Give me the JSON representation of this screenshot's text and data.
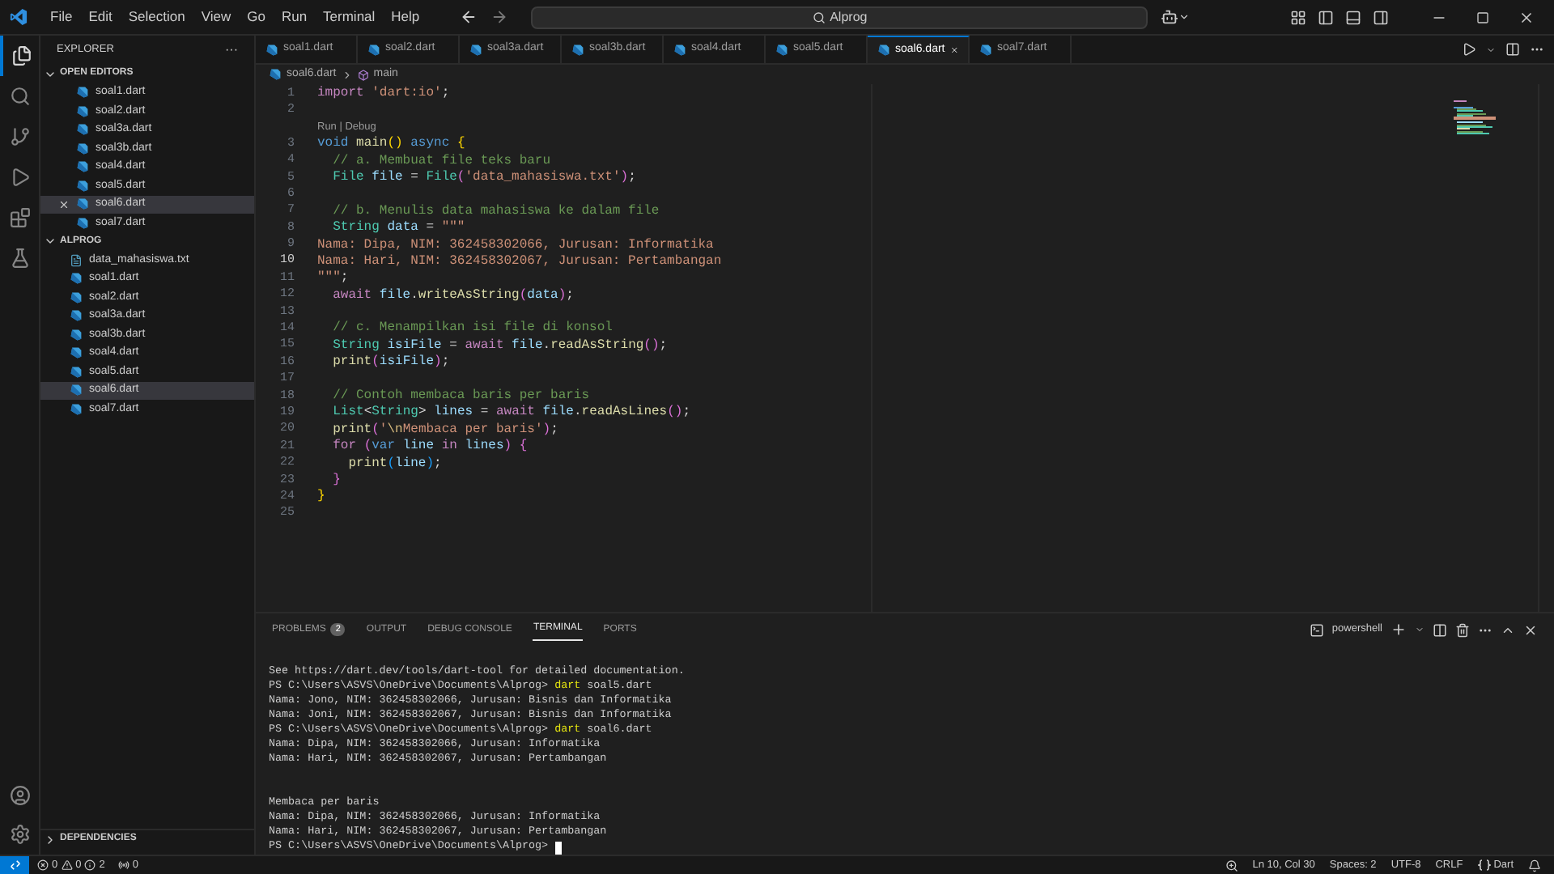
{
  "menu": [
    "File",
    "Edit",
    "Selection",
    "View",
    "Go",
    "Run",
    "Terminal",
    "Help"
  ],
  "search": {
    "value": "Alprog"
  },
  "sidebar": {
    "title": "EXPLORER",
    "more": "···",
    "sections": [
      {
        "label": "OPEN EDITORS",
        "expanded": true,
        "items": [
          {
            "label": "soal1.dart",
            "kind": "dart",
            "selected": false
          },
          {
            "label": "soal2.dart",
            "kind": "dart",
            "selected": false
          },
          {
            "label": "soal3a.dart",
            "kind": "dart",
            "selected": false
          },
          {
            "label": "soal3b.dart",
            "kind": "dart",
            "selected": false
          },
          {
            "label": "soal4.dart",
            "kind": "dart",
            "selected": false
          },
          {
            "label": "soal5.dart",
            "kind": "dart",
            "selected": false
          },
          {
            "label": "soal6.dart",
            "kind": "dart",
            "selected": true
          },
          {
            "label": "soal7.dart",
            "kind": "dart",
            "selected": false
          }
        ]
      },
      {
        "label": "ALPROG",
        "expanded": true,
        "items": [
          {
            "label": "data_mahasiswa.txt",
            "kind": "text",
            "selected": false
          },
          {
            "label": "soal1.dart",
            "kind": "dart",
            "selected": false
          },
          {
            "label": "soal2.dart",
            "kind": "dart",
            "selected": false
          },
          {
            "label": "soal3a.dart",
            "kind": "dart",
            "selected": false
          },
          {
            "label": "soal3b.dart",
            "kind": "dart",
            "selected": false
          },
          {
            "label": "soal4.dart",
            "kind": "dart",
            "selected": false
          },
          {
            "label": "soal5.dart",
            "kind": "dart",
            "selected": false
          },
          {
            "label": "soal6.dart",
            "kind": "dart",
            "selected": true
          },
          {
            "label": "soal7.dart",
            "kind": "dart",
            "selected": false
          }
        ]
      }
    ],
    "footer": {
      "label": "DEPENDENCIES",
      "expanded": false
    }
  },
  "tabs": [
    {
      "label": "soal1.dart",
      "selected": false
    },
    {
      "label": "soal2.dart",
      "selected": false
    },
    {
      "label": "soal3a.dart",
      "selected": false
    },
    {
      "label": "soal3b.dart",
      "selected": false
    },
    {
      "label": "soal4.dart",
      "selected": false
    },
    {
      "label": "soal5.dart",
      "selected": false
    },
    {
      "label": "soal6.dart",
      "selected": true
    },
    {
      "label": "soal7.dart",
      "selected": false
    }
  ],
  "breadcrumb": [
    "soal6.dart",
    "main"
  ],
  "code": [
    {
      "kind": "code",
      "number": "1",
      "current": false,
      "tokens": [
        {
          "text": "import ",
          "kind": "keyword"
        },
        {
          "text": "'dart:io'",
          "kind": "string"
        },
        {
          "text": ";",
          "kind": "plain"
        }
      ]
    },
    {
      "kind": "code",
      "number": "2",
      "current": false
    },
    {
      "kind": "codelens",
      "text": "Run | Debug"
    },
    {
      "kind": "code",
      "number": "3",
      "current": false,
      "tokens": [
        {
          "text": "void ",
          "kind": "storage"
        },
        {
          "text": "main",
          "kind": "function"
        },
        {
          "text": "() ",
          "kind": "bracket1"
        },
        {
          "text": "async ",
          "kind": "storage"
        },
        {
          "text": "{",
          "kind": "bracket1"
        }
      ]
    },
    {
      "kind": "code",
      "number": "4",
      "current": false,
      "tokens": [
        {
          "text": "  // a. Membuat file teks baru",
          "kind": "comment"
        }
      ]
    },
    {
      "kind": "code",
      "number": "5",
      "current": false,
      "tokens": [
        {
          "text": "  File ",
          "kind": "type"
        },
        {
          "text": "file",
          "kind": "variable"
        },
        {
          "text": " = ",
          "kind": "plain"
        },
        {
          "text": "File",
          "kind": "type"
        },
        {
          "text": "(",
          "kind": "bracket2"
        },
        {
          "text": "'data_mahasiswa.txt'",
          "kind": "string"
        },
        {
          "text": ")",
          "kind": "bracket2"
        },
        {
          "text": ";",
          "kind": "plain"
        }
      ]
    },
    {
      "kind": "code",
      "number": "6",
      "current": false
    },
    {
      "kind": "code",
      "number": "7",
      "current": false,
      "tokens": [
        {
          "text": "  // b. Menulis data mahasiswa ke dalam file",
          "kind": "comment"
        }
      ]
    },
    {
      "kind": "code",
      "number": "8",
      "current": false,
      "tokens": [
        {
          "text": "  String ",
          "kind": "type"
        },
        {
          "text": "data",
          "kind": "variable"
        },
        {
          "text": " = ",
          "kind": "plain"
        },
        {
          "text": "\"\"\"",
          "kind": "string"
        }
      ]
    },
    {
      "kind": "code",
      "number": "9",
      "current": false,
      "tokens": [
        {
          "text": "Nama: Dipa, NIM: 362458302066, Jurusan: Informatika",
          "kind": "string"
        }
      ]
    },
    {
      "kind": "code",
      "number": "10",
      "current": true,
      "tokens": [
        {
          "text": "Nama: Hari, NIM: 362458302067, Jurusan: Pertambangan",
          "kind": "string"
        }
      ]
    },
    {
      "kind": "code",
      "number": "11",
      "current": false,
      "tokens": [
        {
          "text": "\"\"\"",
          "kind": "string"
        },
        {
          "text": ";",
          "kind": "plain"
        }
      ]
    },
    {
      "kind": "code",
      "number": "12",
      "current": false,
      "tokens": [
        {
          "text": "  await ",
          "kind": "keyword"
        },
        {
          "text": "file",
          "kind": "variable"
        },
        {
          "text": ".",
          "kind": "plain"
        },
        {
          "text": "writeAsString",
          "kind": "function"
        },
        {
          "text": "(",
          "kind": "bracket2"
        },
        {
          "text": "data",
          "kind": "variable"
        },
        {
          "text": ")",
          "kind": "bracket2"
        },
        {
          "text": ";",
          "kind": "plain"
        }
      ]
    },
    {
      "kind": "code",
      "number": "13",
      "current": false
    },
    {
      "kind": "code",
      "number": "14",
      "current": false,
      "tokens": [
        {
          "text": "  // c. Menampilkan isi file di konsol",
          "kind": "comment"
        }
      ]
    },
    {
      "kind": "code",
      "number": "15",
      "current": false,
      "tokens": [
        {
          "text": "  String ",
          "kind": "type"
        },
        {
          "text": "isiFile",
          "kind": "variable"
        },
        {
          "text": " = ",
          "kind": "plain"
        },
        {
          "text": "await ",
          "kind": "keyword"
        },
        {
          "text": "file",
          "kind": "variable"
        },
        {
          "text": ".",
          "kind": "plain"
        },
        {
          "text": "readAsString",
          "kind": "function"
        },
        {
          "text": "()",
          "kind": "bracket2"
        },
        {
          "text": ";",
          "kind": "plain"
        }
      ]
    },
    {
      "kind": "code",
      "number": "16",
      "current": false,
      "tokens": [
        {
          "text": "  print",
          "kind": "function"
        },
        {
          "text": "(",
          "kind": "bracket2"
        },
        {
          "text": "isiFile",
          "kind": "variable"
        },
        {
          "text": ")",
          "kind": "bracket2"
        },
        {
          "text": ";",
          "kind": "plain"
        }
      ]
    },
    {
      "kind": "code",
      "number": "17",
      "current": false
    },
    {
      "kind": "code",
      "number": "18",
      "current": false,
      "tokens": [
        {
          "text": "  // Contoh membaca baris per baris",
          "kind": "comment"
        }
      ]
    },
    {
      "kind": "code",
      "number": "19",
      "current": false,
      "tokens": [
        {
          "text": "  List",
          "kind": "type"
        },
        {
          "text": "<",
          "kind": "plain"
        },
        {
          "text": "String",
          "kind": "type"
        },
        {
          "text": "> ",
          "kind": "plain"
        },
        {
          "text": "lines",
          "kind": "variable"
        },
        {
          "text": " = ",
          "kind": "plain"
        },
        {
          "text": "await ",
          "kind": "keyword"
        },
        {
          "text": "file",
          "kind": "variable"
        },
        {
          "text": ".",
          "kind": "plain"
        },
        {
          "text": "readAsLines",
          "kind": "function"
        },
        {
          "text": "()",
          "kind": "bracket2"
        },
        {
          "text": ";",
          "kind": "plain"
        }
      ]
    },
    {
      "kind": "code",
      "number": "20",
      "current": false,
      "tokens": [
        {
          "text": "  print",
          "kind": "function"
        },
        {
          "text": "(",
          "kind": "bracket2"
        },
        {
          "text": "'",
          "kind": "string"
        },
        {
          "text": "\\n",
          "kind": "escape"
        },
        {
          "text": "Membaca per baris'",
          "kind": "string"
        },
        {
          "text": ")",
          "kind": "bracket2"
        },
        {
          "text": ";",
          "kind": "plain"
        }
      ]
    },
    {
      "kind": "code",
      "number": "21",
      "current": false,
      "tokens": [
        {
          "text": "  for ",
          "kind": "keyword"
        },
        {
          "text": "(",
          "kind": "bracket2"
        },
        {
          "text": "var ",
          "kind": "storage"
        },
        {
          "text": "line ",
          "kind": "variable"
        },
        {
          "text": "in ",
          "kind": "keyword"
        },
        {
          "text": "lines",
          "kind": "variable"
        },
        {
          "text": ") ",
          "kind": "bracket2"
        },
        {
          "text": "{",
          "kind": "bracket2"
        }
      ]
    },
    {
      "kind": "code",
      "number": "22",
      "current": false,
      "tokens": [
        {
          "text": "    print",
          "kind": "function"
        },
        {
          "text": "(",
          "kind": "bracket3"
        },
        {
          "text": "line",
          "kind": "variable"
        },
        {
          "text": ")",
          "kind": "bracket3"
        },
        {
          "text": ";",
          "kind": "plain"
        }
      ]
    },
    {
      "kind": "code",
      "number": "23",
      "current": false,
      "tokens": [
        {
          "text": "  }",
          "kind": "bracket2"
        }
      ]
    },
    {
      "kind": "code",
      "number": "24",
      "current": false,
      "tokens": [
        {
          "text": "}",
          "kind": "bracket1"
        }
      ]
    },
    {
      "kind": "code",
      "number": "25",
      "current": false
    }
  ],
  "panel": {
    "tabs": [
      {
        "label": "PROBLEMS",
        "badge": "2",
        "selected": false
      },
      {
        "label": "OUTPUT",
        "selected": false
      },
      {
        "label": "DEBUG CONSOLE",
        "selected": false
      },
      {
        "label": "TERMINAL",
        "selected": true
      },
      {
        "label": "PORTS",
        "selected": false
      }
    ],
    "shell": "powershell",
    "terminal": [
      {
        "kind": "output",
        "text": "See https://dart.dev/tools/dart-tool for detailed documentation."
      },
      {
        "kind": "prompt",
        "prompt": "PS C:\\Users\\ASVS\\OneDrive\\Documents\\Alprog>",
        "command": "dart",
        "args": "soal5.dart"
      },
      {
        "kind": "output",
        "text": "Nama: Jono, NIM: 362458302066, Jurusan: Bisnis dan Informatika"
      },
      {
        "kind": "output",
        "text": "Nama: Joni, NIM: 362458302067, Jurusan: Bisnis dan Informatika"
      },
      {
        "kind": "prompt",
        "prompt": "PS C:\\Users\\ASVS\\OneDrive\\Documents\\Alprog>",
        "command": "dart",
        "args": "soal6.dart"
      },
      {
        "kind": "output",
        "text": "Nama: Dipa, NIM: 362458302066, Jurusan: Informatika"
      },
      {
        "kind": "output",
        "text": "Nama: Hari, NIM: 362458302067, Jurusan: Pertambangan"
      },
      {
        "kind": "blank"
      },
      {
        "kind": "blank"
      },
      {
        "kind": "output",
        "text": "Membaca per baris"
      },
      {
        "kind": "output",
        "text": "Nama: Dipa, NIM: 362458302066, Jurusan: Informatika"
      },
      {
        "kind": "output",
        "text": "Nama: Hari, NIM: 362458302067, Jurusan: Pertambangan"
      },
      {
        "kind": "cursor",
        "prompt": "PS C:\\Users\\ASVS\\OneDrive\\Documents\\Alprog>"
      }
    ]
  },
  "status": {
    "errors": "0",
    "warnings": "0",
    "infos": "2",
    "ports": "0",
    "position": "Ln 10, Col 30",
    "indent": "Spaces: 2",
    "encoding": "UTF-8",
    "eol": "CRLF",
    "language": "Dart"
  }
}
